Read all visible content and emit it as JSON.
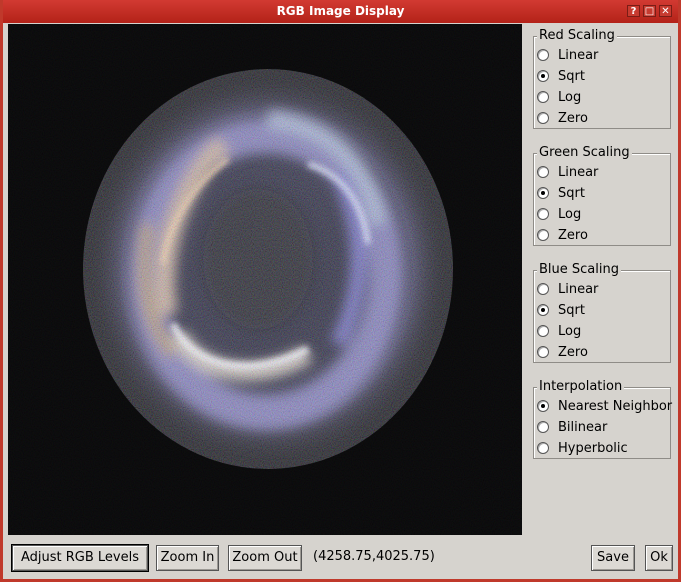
{
  "window": {
    "title": "RGB Image Display"
  },
  "title_buttons": [
    {
      "name": "help-button",
      "glyph": "?"
    },
    {
      "name": "maximize-button",
      "glyph": "□"
    },
    {
      "name": "close-button",
      "glyph": "✕"
    }
  ],
  "groups": [
    {
      "title": "Red Scaling",
      "options": [
        "Linear",
        "Sqrt",
        "Log",
        "Zero"
      ],
      "selected": 1
    },
    {
      "title": "Green Scaling",
      "options": [
        "Linear",
        "Sqrt",
        "Log",
        "Zero"
      ],
      "selected": 1
    },
    {
      "title": "Blue Scaling",
      "options": [
        "Linear",
        "Sqrt",
        "Log",
        "Zero"
      ],
      "selected": 1
    },
    {
      "title": "Interpolation",
      "options": [
        "Nearest Neighbor",
        "Bilinear",
        "Hyperbolic"
      ],
      "selected": 0
    }
  ],
  "buttons": {
    "adjust": "Adjust RGB Levels",
    "zoom_in": "Zoom In",
    "zoom_out": "Zoom Out",
    "save": "Save",
    "ok": "Ok"
  },
  "status": {
    "coordinates": "(4258.75,4025.75)"
  }
}
